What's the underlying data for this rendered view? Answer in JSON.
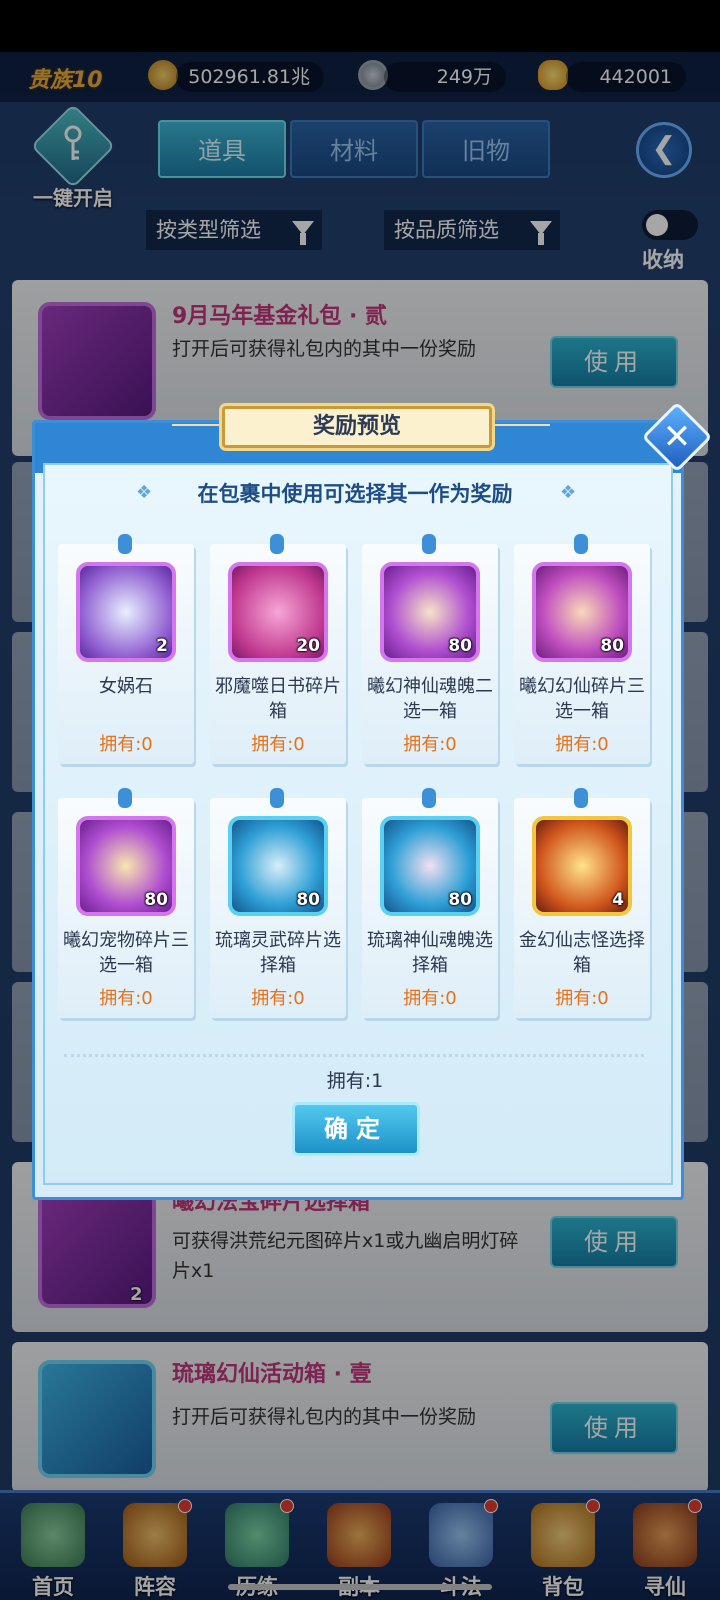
{
  "resources": {
    "vip": "贵族10",
    "power": "502961.81兆",
    "coins": "249万",
    "gold": "442001"
  },
  "header": {
    "one_key_open": "一键开启",
    "tabs": [
      {
        "label": "道具",
        "active": true
      },
      {
        "label": "材料",
        "active": false
      },
      {
        "label": "旧物",
        "active": false
      }
    ],
    "filter_type": "按类型筛选",
    "filter_quality": "按品质筛选",
    "collapse_label": "收纳"
  },
  "list": {
    "items": [
      {
        "title": "9月马年基金礼包 · 贰",
        "desc": "打开后可获得礼包内的其中一份奖励",
        "button": "使用"
      },
      {
        "title": "曦幻法宝碎片选择箱",
        "desc": "可获得洪荒纪元图碎片x1或九幽启明灯碎片x1",
        "button": "使用",
        "count": "2"
      },
      {
        "title": "琉璃幻仙活动箱 · 壹",
        "desc": "打开后可获得礼包内的其中一份奖励",
        "button": "使用"
      }
    ]
  },
  "modal": {
    "title": "奖励预览",
    "subtitle": "在包裹中使用可选择其一作为奖励",
    "rewards": [
      {
        "name": "女娲石",
        "count": "2",
        "owned": "拥有:0",
        "icon": "crystal-icon"
      },
      {
        "name": "邪魔噬日书碎片箱",
        "count": "20",
        "owned": "拥有:0",
        "icon": "gift-box-icon"
      },
      {
        "name": "曦幻神仙魂魄二选一箱",
        "count": "80",
        "owned": "拥有:0",
        "icon": "chest-icon"
      },
      {
        "name": "曦幻幻仙碎片三选一箱",
        "count": "80",
        "owned": "拥有:0",
        "icon": "chest-icon"
      },
      {
        "name": "曦幻宠物碎片三选一箱",
        "count": "80",
        "owned": "拥有:0",
        "icon": "chest-icon"
      },
      {
        "name": "琉璃灵武碎片选择箱",
        "count": "80",
        "owned": "拥有:0",
        "icon": "chest-icon"
      },
      {
        "name": "琉璃神仙魂魄选择箱",
        "count": "80",
        "owned": "拥有:0",
        "icon": "chest-icon"
      },
      {
        "name": "金幻仙志怪选择箱",
        "count": "4",
        "owned": "拥有:0",
        "icon": "treasure-chest-icon"
      }
    ],
    "owned_total": "拥有:1",
    "confirm": "确定",
    "colors": {
      "accent": "#2f86d4",
      "owned": "#e3731c"
    }
  },
  "nav": {
    "items": [
      {
        "label": "首页",
        "badge": false
      },
      {
        "label": "阵容",
        "badge": true
      },
      {
        "label": "历练",
        "badge": true
      },
      {
        "label": "副本",
        "badge": false
      },
      {
        "label": "斗法",
        "badge": true
      },
      {
        "label": "背包",
        "badge": true
      },
      {
        "label": "寻仙",
        "badge": true
      }
    ]
  }
}
